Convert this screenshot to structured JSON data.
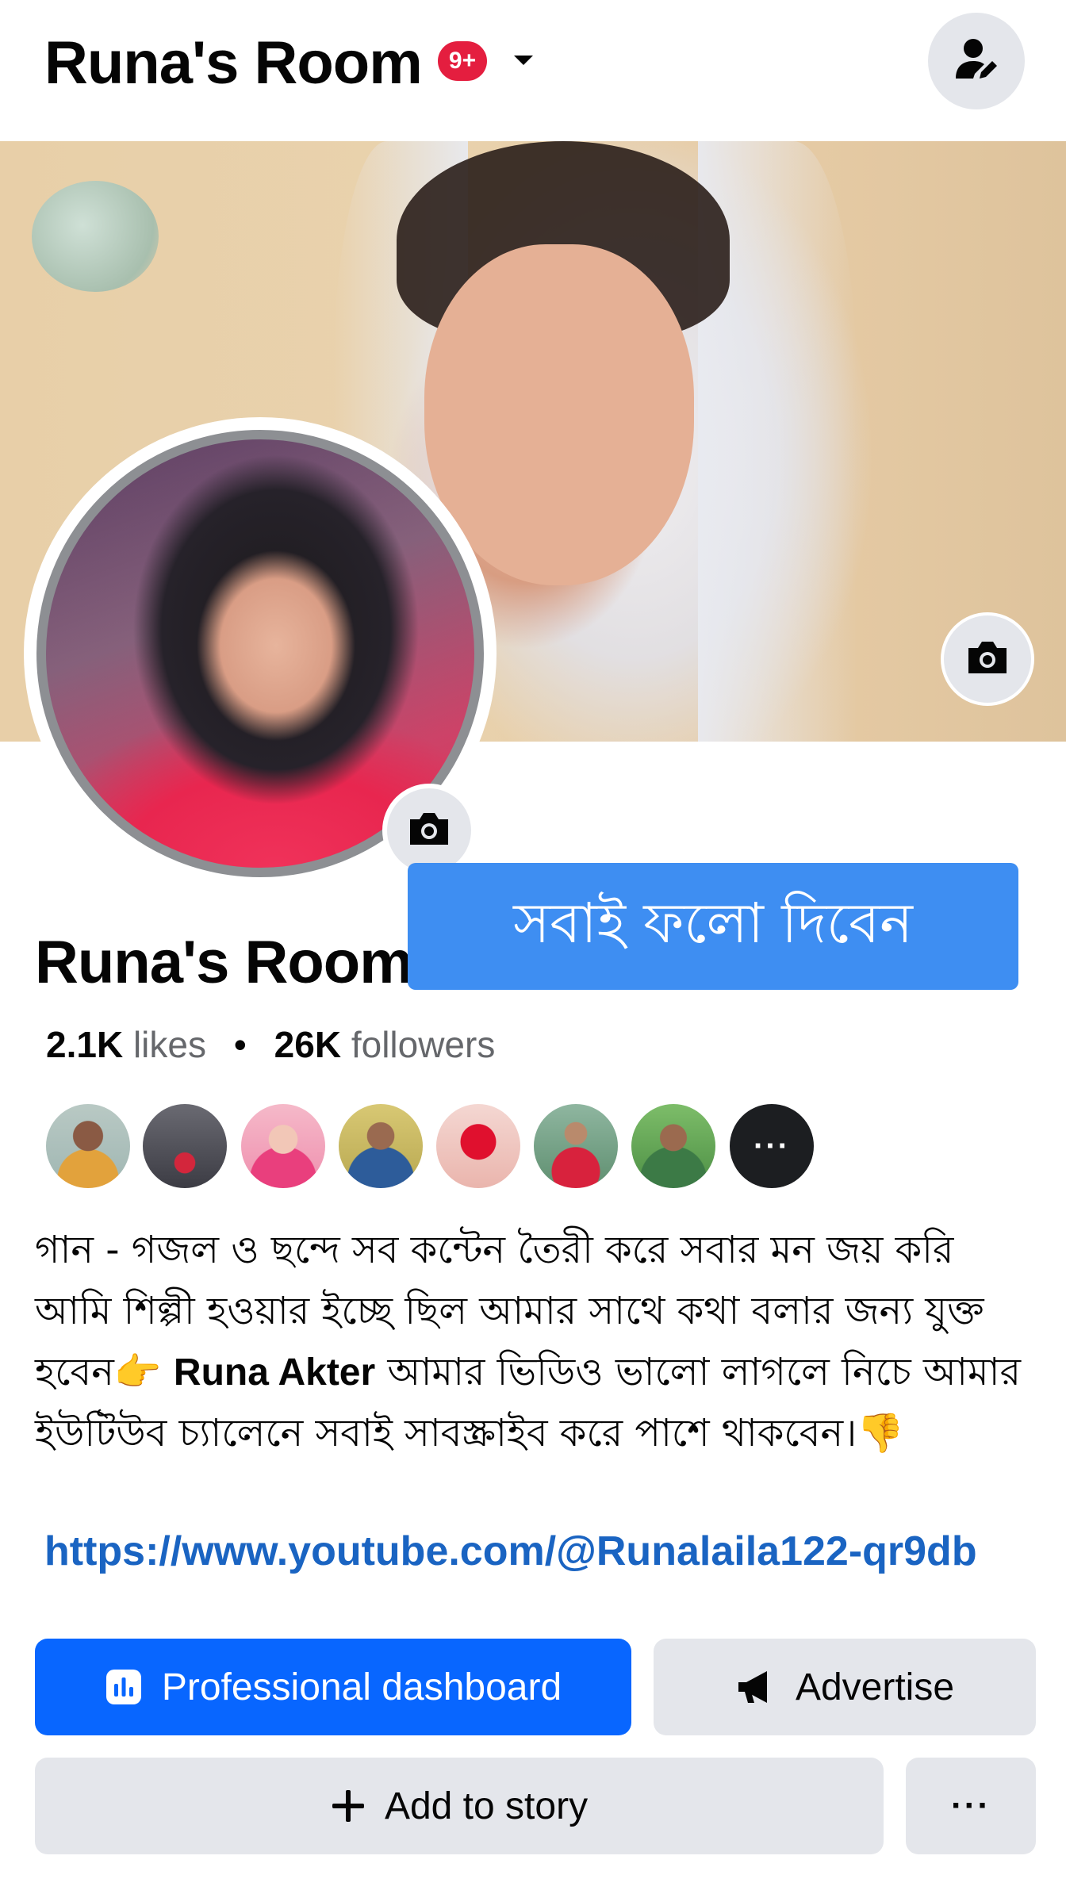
{
  "header": {
    "title": "Runa's Room",
    "notification_badge": "9+",
    "caret_icon": "chevron-down-icon",
    "switch_profile_icon": "person-edit-icon"
  },
  "cover": {
    "camera_icon": "camera-icon"
  },
  "avatar": {
    "camera_icon": "camera-icon"
  },
  "overlay": {
    "banner_text": "সবাই ফলো দিবেন"
  },
  "profile": {
    "name": "Runa's Room",
    "likes_count": "2.1K",
    "likes_label": "likes",
    "separator": "•",
    "followers_count": "26K",
    "followers_label": "followers"
  },
  "followers_preview": {
    "more_label": "···"
  },
  "bio": {
    "text_part1": "গান - গজল ও ছন্দে সব কন্টেন তৈরী করে সবার মন জয় করি আমি শিল্পী হওয়ার ইচ্ছে ছিল আমার সাথে কথা বলার জন্য যুক্ত হবেন👉 ",
    "mention": "Runa Akter",
    "text_part2": " আমার ভিডিও ভালো লাগলে নিচে আমার ইউটিউব চ্যালেনে সবাই সাবস্ক্রাইব করে পাশে থাকবেন।👎",
    "link": "https://www.youtube.com/@Runalaila122-qr9db"
  },
  "actions": {
    "dashboard_label": "Professional dashboard",
    "advertise_label": "Advertise",
    "add_story_label": "Add to story",
    "more_label": "···"
  },
  "colors": {
    "accent_blue": "#0866ff",
    "link_blue": "#1a64c2",
    "badge_red": "#e41e3f",
    "banner_blue": "#3e8ef2",
    "button_gray": "#e4e6eb"
  }
}
